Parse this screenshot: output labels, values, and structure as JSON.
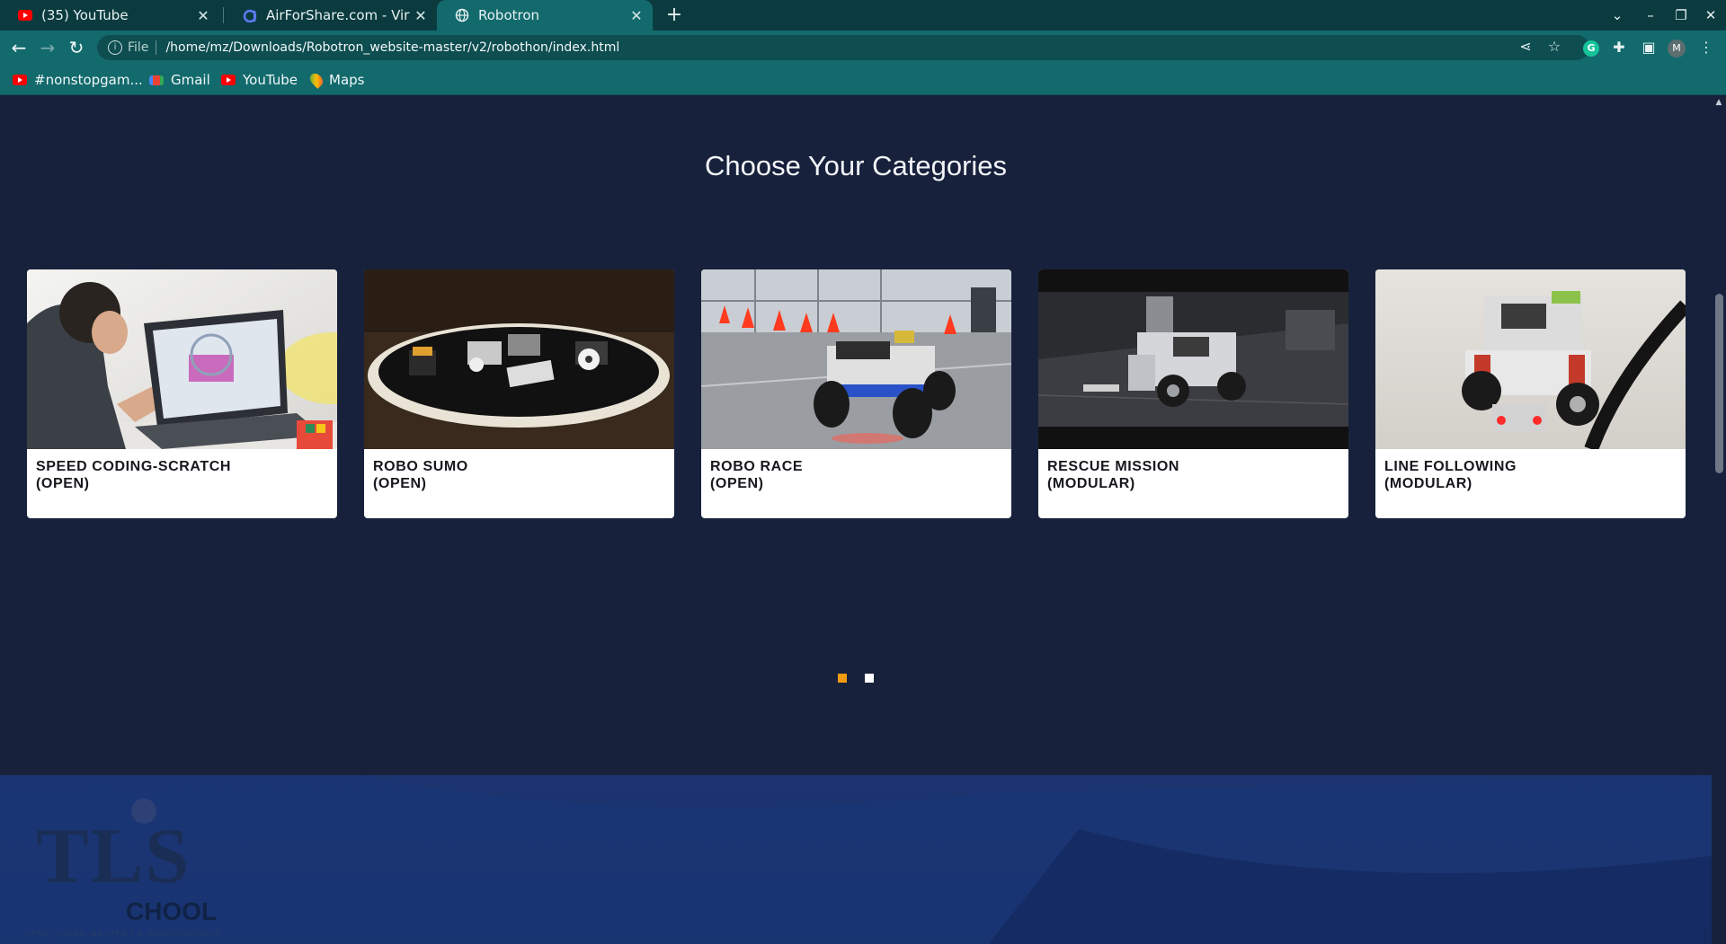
{
  "browser": {
    "tabs": [
      {
        "title": "(35) YouTube",
        "favicon": "youtube-icon"
      },
      {
        "title": "AirForShare.com - Virtual",
        "favicon": "airforshare-icon"
      },
      {
        "title": "Robotron",
        "favicon": "globe-icon",
        "active": true
      }
    ],
    "address": {
      "scheme": "File",
      "url": "/home/mz/Downloads/Robotron_website-master/v2/robothon/index.html"
    },
    "bookmarks": [
      {
        "label": "#nonstopgam...",
        "icon": "youtube-icon"
      },
      {
        "label": "Gmail",
        "icon": "gmail-icon"
      },
      {
        "label": "YouTube",
        "icon": "youtube-icon"
      },
      {
        "label": "Maps",
        "icon": "maps-icon"
      }
    ],
    "profile_initial": "M",
    "extension_initial": "G"
  },
  "page": {
    "section_title": "Choose Your Categories",
    "categories": [
      {
        "line1": "SPEED CODING-SCRATCH",
        "line2": "(OPEN)",
        "image": "boy-with-laptop-photo"
      },
      {
        "line1": "ROBO SUMO",
        "line2": "(OPEN)",
        "image": "sumo-ring-robots-photo"
      },
      {
        "line1": "ROBO RACE",
        "line2": "(OPEN)",
        "image": "rc-robot-with-cones-photo"
      },
      {
        "line1": "RESCUE MISSION",
        "line2": "(MODULAR)",
        "image": "lego-robot-arm-photo"
      },
      {
        "line1": "LINE FOLLOWING",
        "line2": "(MODULAR)",
        "image": "lego-line-follower-photo"
      }
    ],
    "carousel": {
      "pages": 2,
      "active": 1
    },
    "banner": {
      "logo_text": "TLS",
      "school_text": "CHOOL",
      "tagline": "DEVELOPING MASTERY & INDEPENDENCE"
    },
    "colors": {
      "background": "#17213b",
      "dot_active": "#f39c12",
      "dot_idle": "#ffffff",
      "chrome": "#136a6d"
    }
  }
}
